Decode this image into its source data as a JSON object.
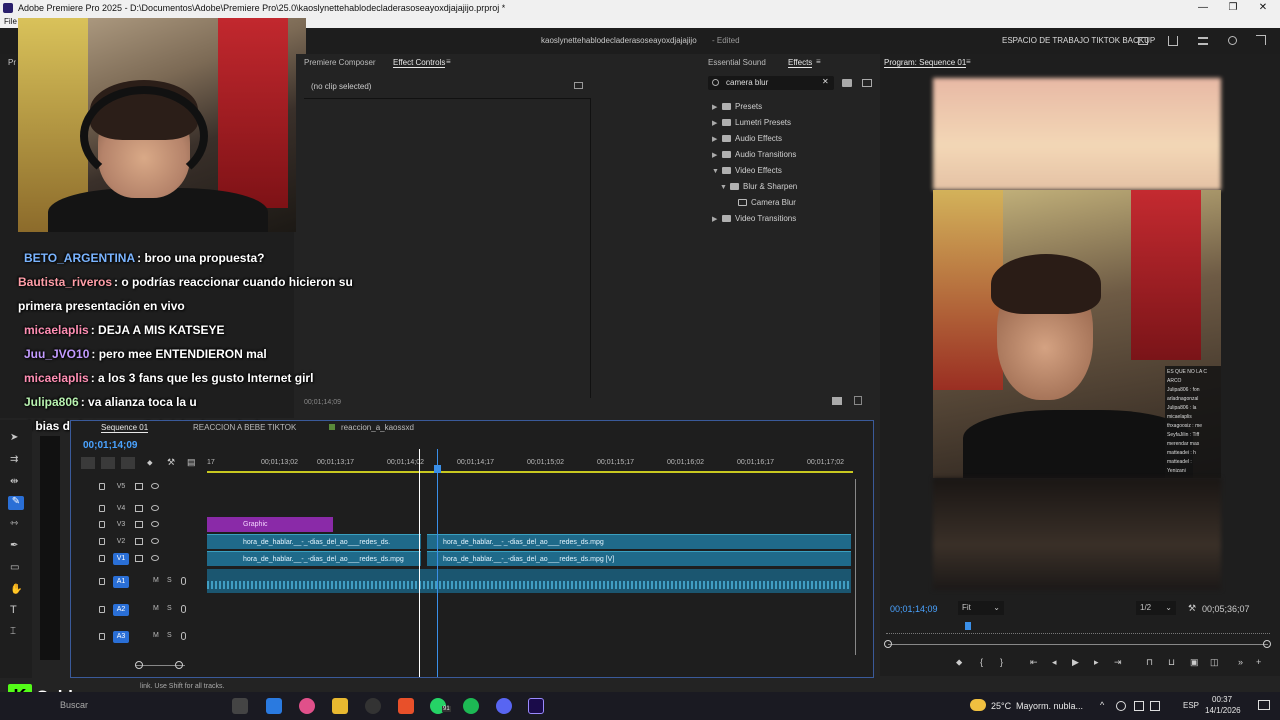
{
  "titlebar": {
    "title": "Adobe Premiere Pro 2025 - D:\\Documentos\\Adobe\\Premiere Pro\\25.0\\kaoslynettehablodecladerasoseayoxdjajajijo.prproj *",
    "minimize": "—",
    "restore": "❐",
    "close": "✕"
  },
  "menubar": {
    "file": "File"
  },
  "header": {
    "project_name": "kaoslynettehablodecladerasoseayoxdjajajijo",
    "edited": "- Edited",
    "workspace": "ESPACIO DE TRABAJO TIKTOK BACKUP"
  },
  "effect_controls": {
    "tab_composer": "Premiere Composer",
    "tab_active": "Effect Controls",
    "no_clip": "(no clip selected)",
    "timecode": "00;01;14;09"
  },
  "effects_panel": {
    "tab_essential": "Essential Sound",
    "tab_effects": "Effects",
    "search_value": "camera blur",
    "tree": [
      {
        "label": "Presets",
        "expanded": false,
        "level": 0,
        "type": "folder"
      },
      {
        "label": "Lumetri Presets",
        "expanded": false,
        "level": 0,
        "type": "folder"
      },
      {
        "label": "Audio Effects",
        "expanded": false,
        "level": 0,
        "type": "folder"
      },
      {
        "label": "Audio Transitions",
        "expanded": false,
        "level": 0,
        "type": "folder"
      },
      {
        "label": "Video Effects",
        "expanded": true,
        "level": 0,
        "type": "folder"
      },
      {
        "label": "Blur & Sharpen",
        "expanded": true,
        "level": 1,
        "type": "folder"
      },
      {
        "label": "Camera Blur",
        "expanded": false,
        "level": 2,
        "type": "effect"
      },
      {
        "label": "Video Transitions",
        "expanded": false,
        "level": 0,
        "type": "folder"
      }
    ]
  },
  "program_monitor": {
    "tab": "Program: Sequence 01",
    "timecode": "00;01;14;09",
    "fit": "Fit",
    "resolution": "1/2",
    "duration": "00;05;36;07",
    "overlay_chat": [
      "ES QUE NO LA C",
      "ARCO",
      "Julipa806 : fon",
      "arladnagonzal",
      "Julipa806 : la",
      "micaelaplis",
      "thxagoosiz : me",
      "SeyfaJilin : Tiff",
      "merendar mas",
      "matteadei : h",
      "matteadel :",
      "Yenizani"
    ]
  },
  "chat": [
    {
      "user": "BETO_ARGENTINA",
      "color": "#7ab4ff",
      "message": ": broo una propuesta?"
    },
    {
      "user": "Bautista_riveros",
      "color": "#ff9ea8",
      "message": ": o podrías reaccionar cuando hicieron su primera presentación en vivo"
    },
    {
      "user": "micaelaplis",
      "color": "#ff8fb4",
      "message": ": DEJA A MIS KATSEYE"
    },
    {
      "user": "Juu_JVO10",
      "color": "#c39bff",
      "message": ": pero mee ENTENDIERON mal"
    },
    {
      "user": "micaelaplis",
      "color": "#ff8fb4",
      "message": ": a los 3 fans que les gusto Internet girl"
    },
    {
      "user": "Julipa806",
      "color": "#b8f2b0",
      "message": ": va alianza toca la u"
    },
    {
      "user": "",
      "color": "#ffffff",
      "message": "mi bias de katseye es Gabriela ahre q decía"
    }
  ],
  "timeline": {
    "tab_sequence": "Sequence 01",
    "tab_reaction": "REACCION A BEBE TIKTOK",
    "tab_other": "reaccion_a_kaossxd",
    "timecode": "00;01;14;09",
    "ruler": [
      "17",
      "00;01;13;02",
      "00;01;13;17",
      "00;01;14;02",
      "00;01;14;17",
      "00;01;15;02",
      "00;01;15;17",
      "00;01;16;02",
      "00;01;16;17",
      "00;01;17;02"
    ],
    "tracks": [
      "V5",
      "V4",
      "V3",
      "V2",
      "V1",
      "A1",
      "A2",
      "A3"
    ],
    "graphic_clip": "Graphic",
    "clip_v2_left": "hora_de_hablar.__-_-dias_del_ao___redes_ds.",
    "clip_v2_right": "hora_de_hablar.__-_-dias_del_ao___redes_ds.mpg",
    "clip_v1_left": "hora_de_hablar.__-_-dias_del_ao___redes_ds.mpg",
    "clip_v1_right": "hora_de_hablar.__-_-dias_del_ao___redes_ds.mpg [V]",
    "fx": "fx"
  },
  "status_bar": {
    "text": "link. Use Shift for all tracks."
  },
  "brand": {
    "name": "Caldeerass",
    "k": "K"
  },
  "taskbar": {
    "search": "Buscar",
    "weather": "25°C",
    "weather_desc": "Mayorm. nubla...",
    "lang": "ESP",
    "time": "00:37",
    "date": "14/1/2026",
    "badge": "91"
  }
}
